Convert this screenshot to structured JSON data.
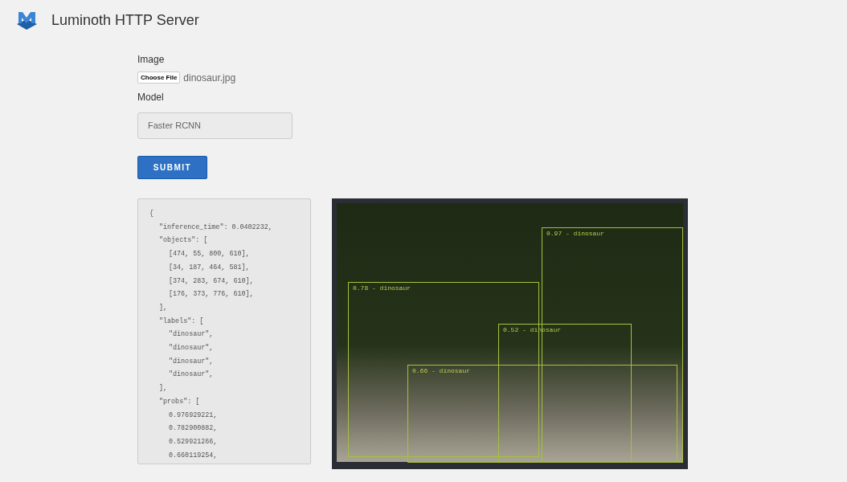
{
  "header": {
    "title": "Luminoth HTTP Server"
  },
  "form": {
    "image_label": "Image",
    "file_button": "Choose File",
    "file_name": "dinosaur.jpg",
    "model_label": "Model",
    "model_value": "Faster RCNN",
    "submit": "SUBMIT"
  },
  "result_json": {
    "lines": [
      {
        "text": "{",
        "children": [
          {
            "text": "\"inference_time\": 0.0402232,"
          },
          {
            "text": "\"objects\": [",
            "children": [
              {
                "text": "[474, 55, 800, 610],"
              },
              {
                "text": "[34, 187, 464, 581],"
              },
              {
                "text": "[374, 283, 674, 610],"
              },
              {
                "text": "[176, 373, 776, 610],"
              }
            ]
          },
          {
            "text": "],"
          },
          {
            "text": "\"labels\": [",
            "children": [
              {
                "text": "\"dinosaur\","
              },
              {
                "text": "\"dinosaur\","
              },
              {
                "text": "\"dinosaur\","
              },
              {
                "text": "\"dinosaur\","
              }
            ]
          },
          {
            "text": "],"
          },
          {
            "text": "\"probs\": [",
            "children": [
              {
                "text": "0.976929221,"
              },
              {
                "text": "0.782900882,"
              },
              {
                "text": "0.529921266,"
              },
              {
                "text": "0.660119254,"
              }
            ]
          }
        ]
      }
    ]
  },
  "detections": [
    {
      "label": "0.97 - dinosaur"
    },
    {
      "label": "0.78 - dinosaur"
    },
    {
      "label": "0.52 - dinosaur"
    },
    {
      "label": "0.66 - dinosaur"
    }
  ]
}
